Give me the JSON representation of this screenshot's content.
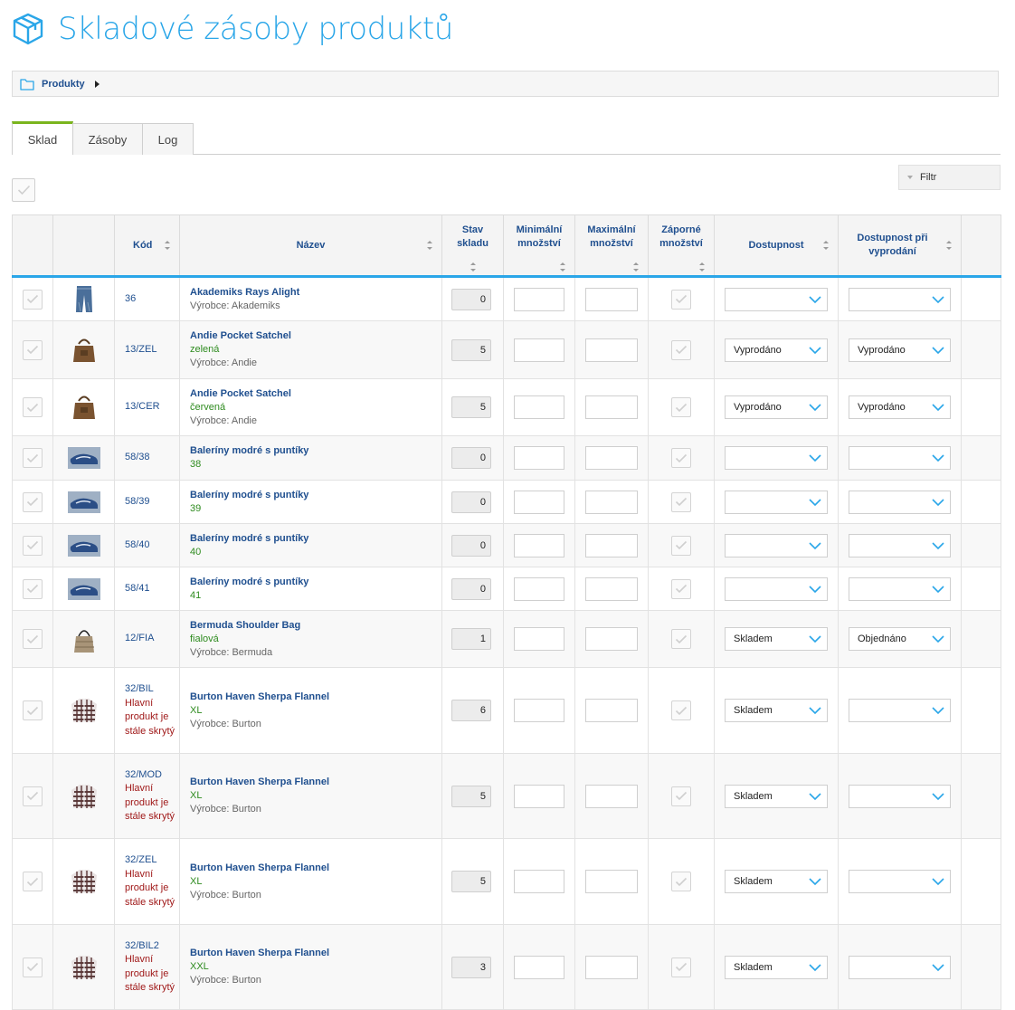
{
  "header": {
    "title": "Skladové zásoby produktů",
    "icon": "box-icon"
  },
  "breadcrumb": {
    "label": "Produkty"
  },
  "tabs": [
    {
      "label": "Sklad",
      "active": true
    },
    {
      "label": "Zásoby",
      "active": false
    },
    {
      "label": "Log",
      "active": false
    }
  ],
  "filter": {
    "label": "Filtr"
  },
  "colors": {
    "accent": "#2aa6e8",
    "link": "#1f4f8f",
    "variant": "#2e8b1f",
    "warning": "#a01a1a",
    "active_tab": "#7ab51d"
  },
  "table": {
    "headers": {
      "code": "Kód",
      "name": "Název",
      "stock": "Stav skladu",
      "min": "Minimální množství",
      "max": "Maximální množství",
      "negative": "Záporné množství",
      "availability": "Dostupnost",
      "availability_sold_out": "Dostupnost při vyprodání"
    },
    "rows": [
      {
        "code": "36",
        "hidden_note": "",
        "name": "Akademiks Rays Alight",
        "variant": "",
        "maker": "Výrobce: Akademiks",
        "stock": "0",
        "availability": "",
        "availability_sold_out": "",
        "image": "jeans-icon"
      },
      {
        "code": "13/ZEL",
        "hidden_note": "",
        "name": "Andie Pocket Satchel",
        "variant": "zelená",
        "maker": "Výrobce: Andie",
        "stock": "5",
        "availability": "Vyprodáno",
        "availability_sold_out": "Vyprodáno",
        "image": "satchel-icon"
      },
      {
        "code": "13/CER",
        "hidden_note": "",
        "name": "Andie Pocket Satchel",
        "variant": "červená",
        "maker": "Výrobce: Andie",
        "stock": "5",
        "availability": "Vyprodáno",
        "availability_sold_out": "Vyprodáno",
        "image": "satchel-icon"
      },
      {
        "code": "58/38",
        "hidden_note": "",
        "name": "Baleríny modré s puntíky",
        "variant": "38",
        "maker": "",
        "stock": "0",
        "availability": "",
        "availability_sold_out": "",
        "image": "shoe-icon"
      },
      {
        "code": "58/39",
        "hidden_note": "",
        "name": "Baleríny modré s puntíky",
        "variant": "39",
        "maker": "",
        "stock": "0",
        "availability": "",
        "availability_sold_out": "",
        "image": "shoe-icon"
      },
      {
        "code": "58/40",
        "hidden_note": "",
        "name": "Baleríny modré s puntíky",
        "variant": "40",
        "maker": "",
        "stock": "0",
        "availability": "",
        "availability_sold_out": "",
        "image": "shoe-icon"
      },
      {
        "code": "58/41",
        "hidden_note": "",
        "name": "Baleríny modré s puntíky",
        "variant": "41",
        "maker": "",
        "stock": "0",
        "availability": "",
        "availability_sold_out": "",
        "image": "shoe-icon"
      },
      {
        "code": "12/FIA",
        "hidden_note": "",
        "name": "Bermuda Shoulder Bag",
        "variant": "fialová",
        "maker": "Výrobce: Bermuda",
        "stock": "1",
        "availability": "Skladem",
        "availability_sold_out": "Objednáno",
        "image": "shoulder-bag-icon"
      },
      {
        "code": "32/BIL",
        "hidden_note": "Hlavní produkt je stále skrytý",
        "name": "Burton Haven Sherpa Flannel",
        "variant": "XL",
        "maker": "Výrobce: Burton",
        "stock": "6",
        "availability": "Skladem",
        "availability_sold_out": "",
        "image": "flannel-shirt-icon"
      },
      {
        "code": "32/MOD",
        "hidden_note": "Hlavní produkt je stále skrytý",
        "name": "Burton Haven Sherpa Flannel",
        "variant": "XL",
        "maker": "Výrobce: Burton",
        "stock": "5",
        "availability": "Skladem",
        "availability_sold_out": "",
        "image": "flannel-shirt-icon"
      },
      {
        "code": "32/ZEL",
        "hidden_note": "Hlavní produkt je stále skrytý",
        "name": "Burton Haven Sherpa Flannel",
        "variant": "XL",
        "maker": "Výrobce: Burton",
        "stock": "5",
        "availability": "Skladem",
        "availability_sold_out": "",
        "image": "flannel-shirt-icon"
      },
      {
        "code": "32/BIL2",
        "hidden_note": "Hlavní produkt je stále skrytý",
        "name": "Burton Haven Sherpa Flannel",
        "variant": "XXL",
        "maker": "Výrobce: Burton",
        "stock": "3",
        "availability": "Skladem",
        "availability_sold_out": "",
        "image": "flannel-shirt-icon"
      }
    ]
  }
}
